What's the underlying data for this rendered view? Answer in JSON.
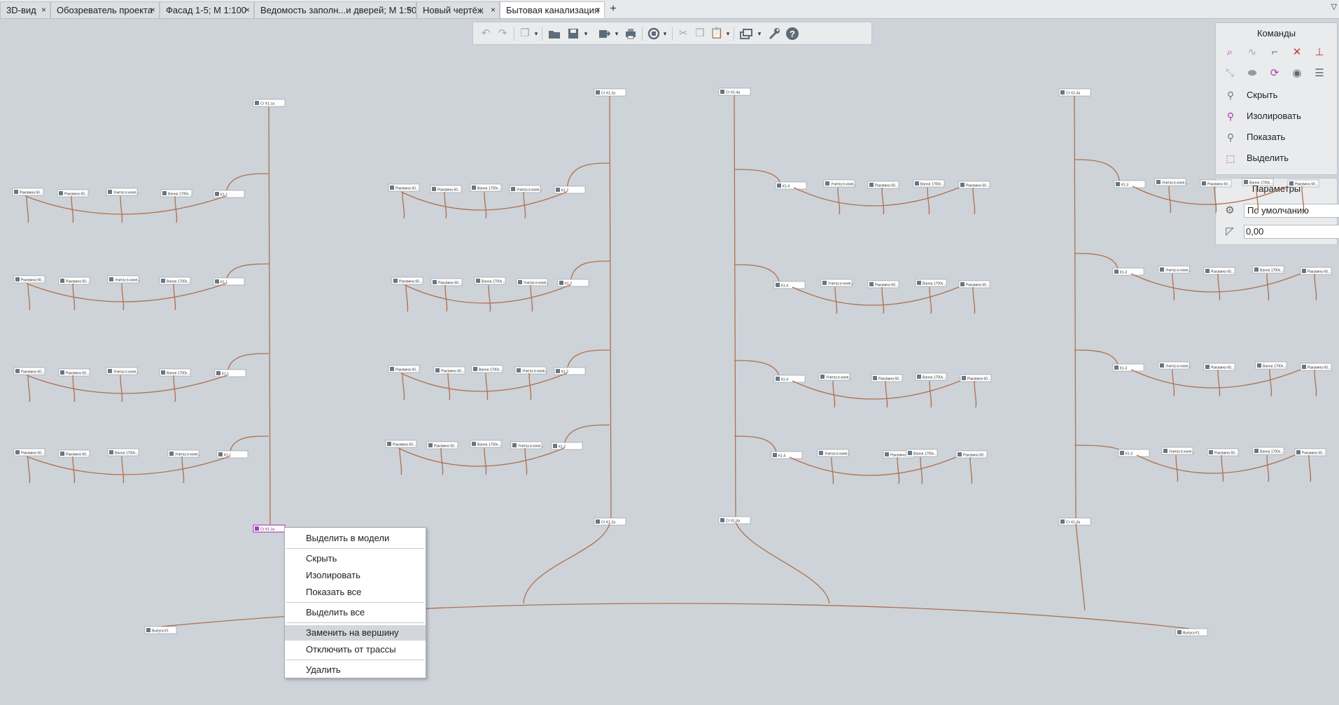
{
  "tabs": [
    {
      "label": "3D-вид",
      "close": "×"
    },
    {
      "label": "Обозреватель проекта",
      "close": "×"
    },
    {
      "label": "Фасад 1-5; М 1:100",
      "close": "×"
    },
    {
      "label": "Ведомость заполн...и дверей; М 1:50",
      "close": "×"
    },
    {
      "label": "Новый чертёж",
      "close": "×"
    },
    {
      "label": "Бытовая канализация",
      "close": "×",
      "active": true
    }
  ],
  "tab_add": "+",
  "tab_menu": "▽",
  "toolbar": {
    "icons": [
      "undo-icon",
      "redo-icon",
      "view-cube-icon",
      "open-folder-icon",
      "save-icon",
      "export-icon",
      "print-icon",
      "sync-icon",
      "cut-icon",
      "copy-icon",
      "paste-icon",
      "windows-icon",
      "settings-wrench-icon",
      "help-icon"
    ]
  },
  "commands_panel": {
    "title": "Команды",
    "items": [
      {
        "label": "Скрыть",
        "dropdown": "▼"
      },
      {
        "label": "Изолировать",
        "dropdown": "▼"
      },
      {
        "label": "Показать",
        "dropdown": "▼"
      },
      {
        "label": "Выделить",
        "dropdown": "▼"
      }
    ]
  },
  "params_panel": {
    "title": "Параметры",
    "preset": "По умолчанию",
    "slope_value": "0,00",
    "slope_unit": "‰"
  },
  "context_menu": {
    "items": [
      "Выделить в модели",
      "Скрыть",
      "Изолировать",
      "Показать все",
      "Выделить все",
      "Заменить на вершину",
      "Отключить от трассы",
      "Удалить"
    ],
    "highlighted": "Заменить на вершину"
  },
  "diagram": {
    "pipe_color": "#b0704e",
    "risers": [
      {
        "top_label": "Ст К1-1а",
        "bottom_label": "Ст К1-1а",
        "floors": [
          {
            "junction": "К1-1",
            "devices": [
              "Раковина 60...",
              "Раковина 60...",
              "Унитаз в комп...",
              "Ванна 1700х..."
            ]
          },
          {
            "junction": "К1-1",
            "devices": [
              "Раковина 60...",
              "Раковина 60...",
              "Унитаз в комп...",
              "Ванна 1700х..."
            ]
          },
          {
            "junction": "К1-1",
            "devices": [
              "Раковина 60...",
              "Раковина 60...",
              "Унитаз в комп...",
              "Ванна 1700х..."
            ]
          },
          {
            "junction": "К1-1",
            "devices": [
              "Раковина 60...",
              "Раковина 60...",
              "Ванна 1700х...",
              "Унитаз в комп..."
            ]
          }
        ]
      },
      {
        "top_label": "Ст К1-2а",
        "bottom_label": "Ст К1-2а",
        "floors": [
          {
            "junction": "К1-2",
            "devices": [
              "Раковина 60...",
              "Раковина 60...",
              "Ванна 1700х...",
              "Унитаз в комп..."
            ]
          },
          {
            "junction": "К1-2",
            "devices": [
              "Раковина 60...",
              "Раковина 60...",
              "Ванна 1700х...",
              "Унитаз в комп..."
            ]
          },
          {
            "junction": "К1-2",
            "devices": [
              "Раковина 60...",
              "Раковина 60...",
              "Ванна 1700х...",
              "Унитаз в комп..."
            ]
          },
          {
            "junction": "К1-2",
            "devices": [
              "Раковина 60...",
              "Раковина 60...",
              "Ванна 1700х...",
              "Унитаз в комп..."
            ]
          }
        ]
      },
      {
        "top_label": "Ст К1-4а",
        "bottom_label": "Ст К1-4а",
        "floors": [
          {
            "junction": "К1-4",
            "devices": [
              "Унитаз в комп...",
              "Раковина 60...",
              "Ванна 1700х...",
              "Раковина 60..."
            ]
          },
          {
            "junction": "К1-4",
            "devices": [
              "Унитаз в комп...",
              "Раковина 60...",
              "Ванна 1700х...",
              "Раковина 60..."
            ]
          },
          {
            "junction": "К1-4",
            "devices": [
              "Унитаз в комп...",
              "Раковина 60...",
              "Ванна 1700х...",
              "Раковина 60..."
            ]
          },
          {
            "junction": "К1-4",
            "devices": [
              "Унитаз в комп...",
              "Раковина 60...",
              "Ванна 1700х...",
              "Раковина 60..."
            ]
          }
        ]
      },
      {
        "top_label": "Ст К1-3а",
        "bottom_label": "Ст К1-3а",
        "floors": [
          {
            "junction": "К1-3",
            "devices": [
              "Унитаз в комп...",
              "Раковина 60...",
              "Ванна 1700х...",
              "Раковина 60..."
            ]
          },
          {
            "junction": "К1-3",
            "devices": [
              "Унитаз в комп...",
              "Раковина 60...",
              "Ванна 1700х...",
              "Раковина 60..."
            ]
          },
          {
            "junction": "К1-3",
            "devices": [
              "Унитаз в комп...",
              "Раковина 60...",
              "Ванна 1700х...",
              "Раковина 60..."
            ]
          },
          {
            "junction": "К1-3",
            "devices": [
              "Унитаз в комп...",
              "Раковина 60...",
              "Ванна 1700х...",
              "Раковина 60..."
            ]
          }
        ]
      }
    ],
    "outlets": [
      {
        "label": "Выпуск К1"
      },
      {
        "label": "Выпуск К1"
      }
    ]
  }
}
